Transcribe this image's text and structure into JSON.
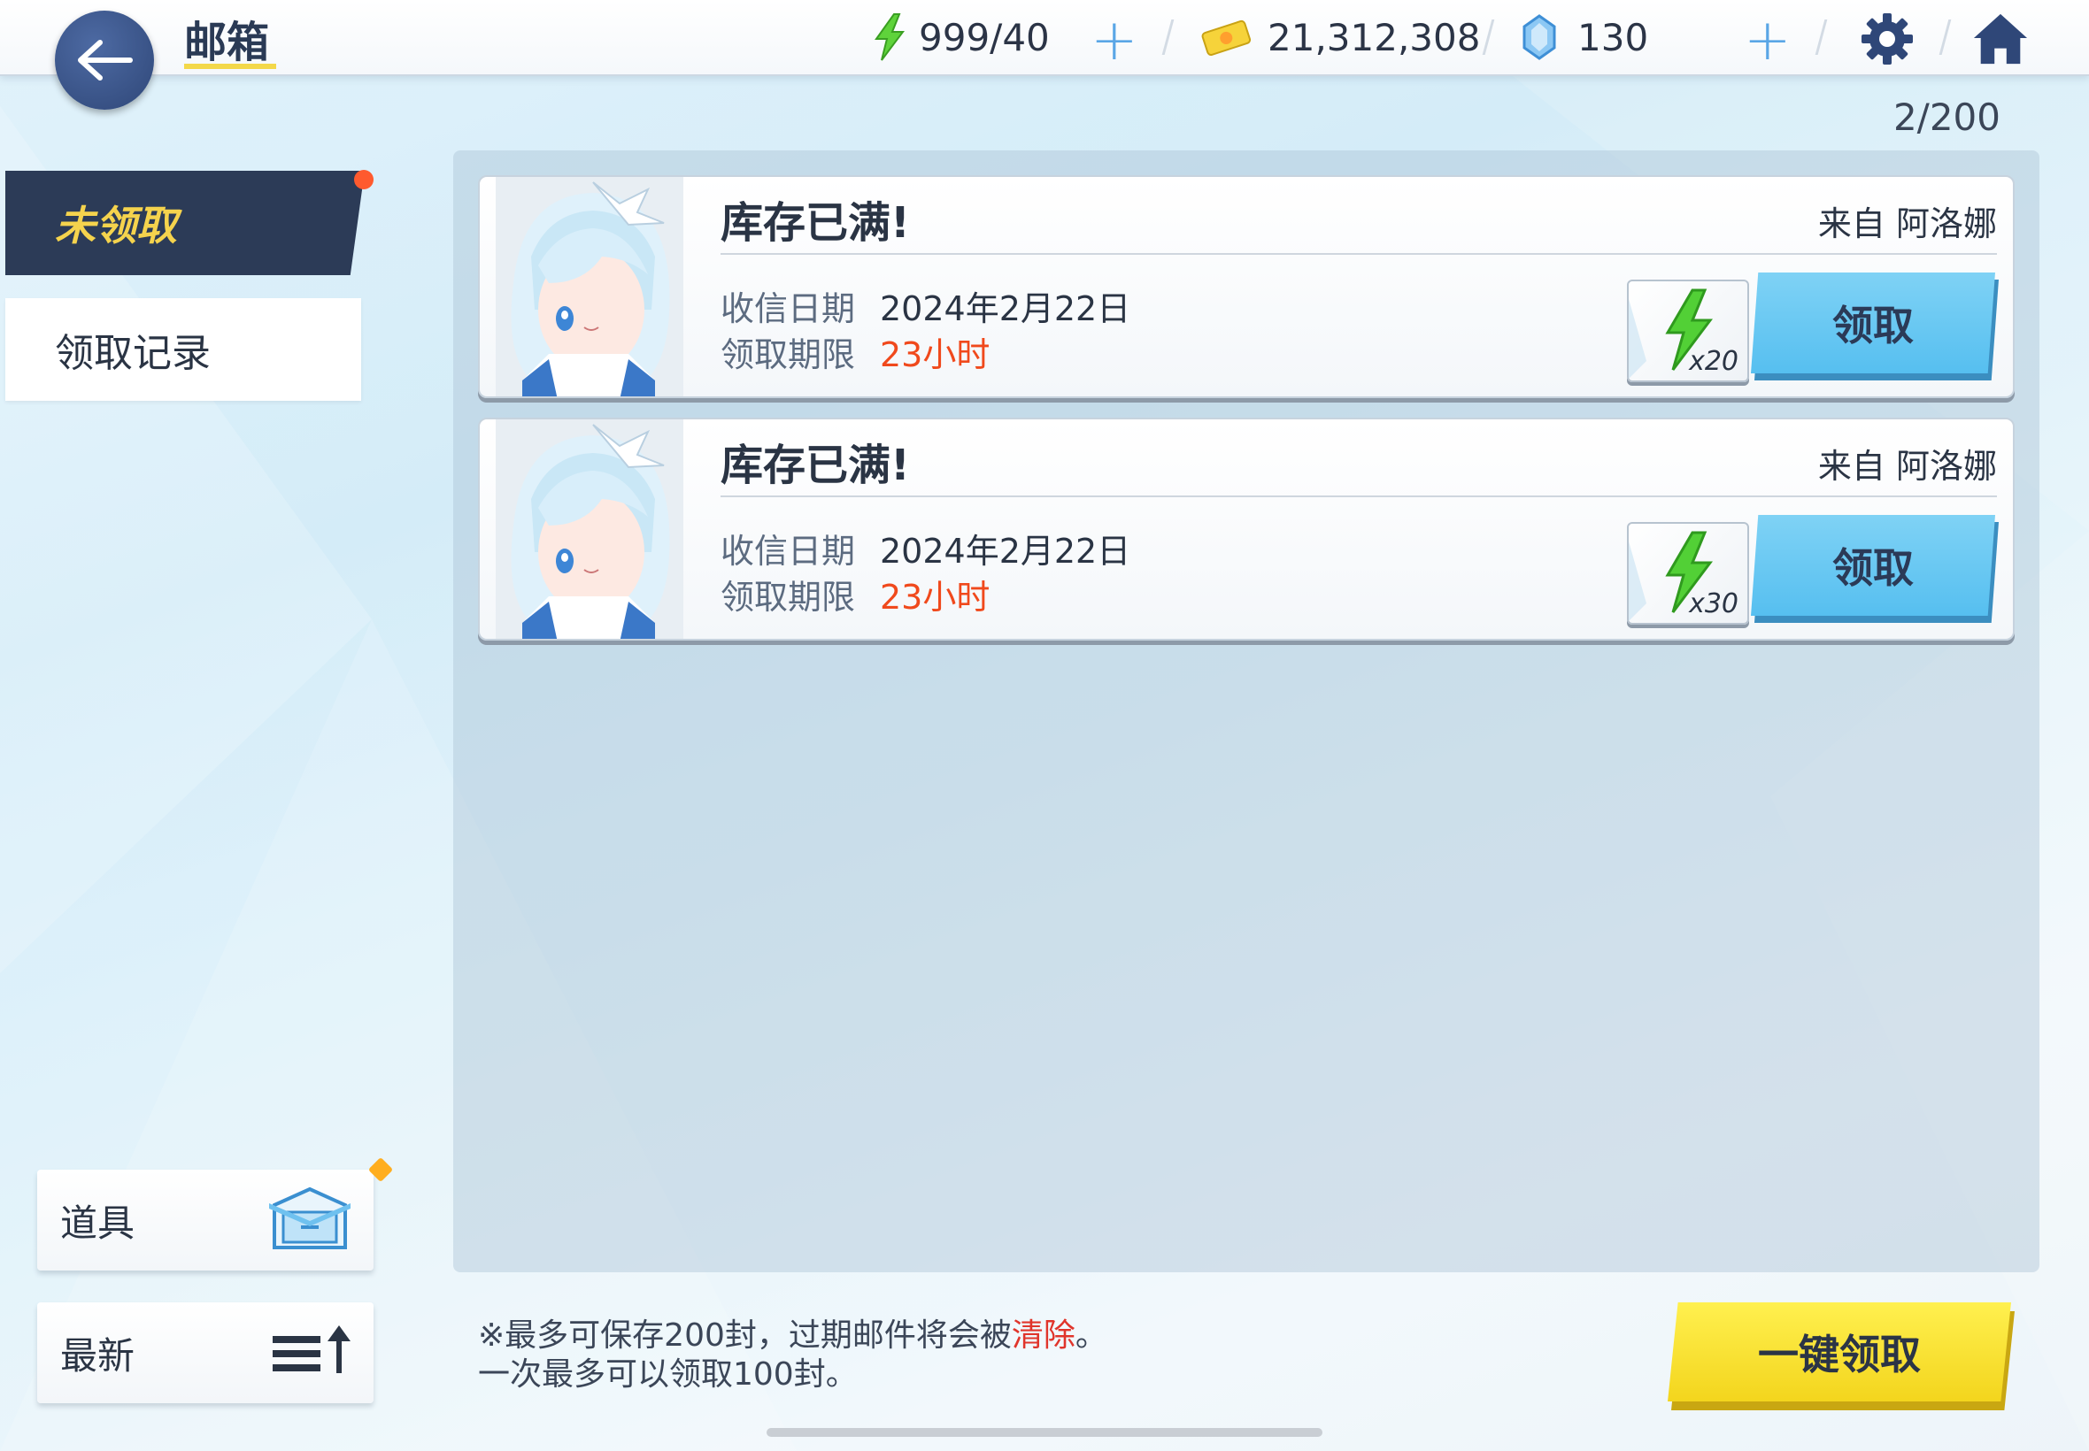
{
  "header": {
    "title": "邮箱",
    "stamina": "999/40",
    "credits": "21,312,308",
    "gems": "130"
  },
  "mail_count": "2/200",
  "tabs": {
    "unclaimed": "未领取",
    "history": "领取记录"
  },
  "side_buttons": {
    "items": "道具",
    "sort": "最新"
  },
  "mails": [
    {
      "title": "库存已满!",
      "sender": "来自 阿洛娜",
      "date_label": "收信日期",
      "date": "2024年2月22日",
      "deadline_label": "领取期限",
      "deadline": "23小时",
      "reward_qty": "x20",
      "claim_label": "领取"
    },
    {
      "title": "库存已满!",
      "sender": "来自 阿洛娜",
      "date_label": "收信日期",
      "date": "2024年2月22日",
      "deadline_label": "领取期限",
      "deadline": "23小时",
      "reward_qty": "x30",
      "claim_label": "领取"
    }
  ],
  "footer": {
    "note_line1_a": "※最多可保存200封，过期邮件将会被",
    "note_line1_red": "清除",
    "note_line1_b": "。",
    "note_line2": "一次最多可以领取100封。",
    "claim_all": "一键领取"
  },
  "colors": {
    "accent_yellow": "#f3d84a",
    "tab_dark": "#2c3b57",
    "claim_blue": "#56bff0",
    "deadline_red": "#f0491c"
  },
  "icons": {
    "back": "arrow-left-icon",
    "stamina": "lightning-icon",
    "credits": "credit-ticket-icon",
    "gems": "crystal-icon",
    "settings": "gear-icon",
    "home": "home-icon",
    "items": "mail-box-icon",
    "sort": "sort-list-up-icon"
  }
}
